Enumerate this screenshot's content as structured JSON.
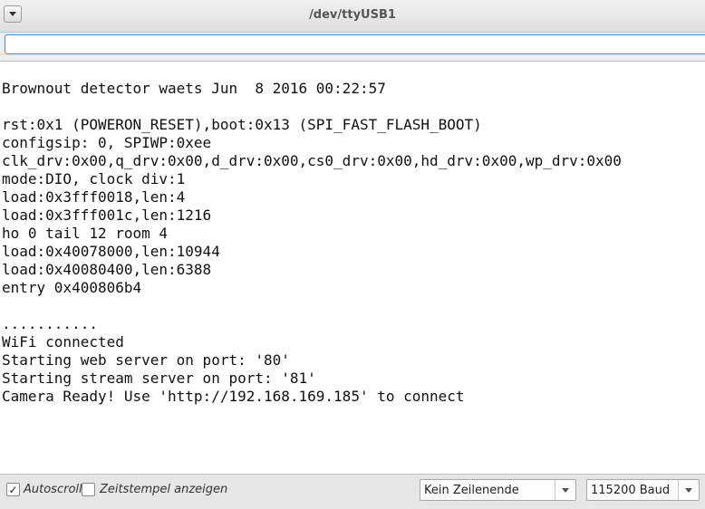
{
  "window": {
    "title": "/dev/ttyUSB1"
  },
  "send": {
    "value": ""
  },
  "console": {
    "lines": [
      "Brownout detector waets Jun  8 2016 00:22:57",
      "",
      "rst:0x1 (POWERON_RESET),boot:0x13 (SPI_FAST_FLASH_BOOT)",
      "configsip: 0, SPIWP:0xee",
      "clk_drv:0x00,q_drv:0x00,d_drv:0x00,cs0_drv:0x00,hd_drv:0x00,wp_drv:0x00",
      "mode:DIO, clock div:1",
      "load:0x3fff0018,len:4",
      "load:0x3fff001c,len:1216",
      "ho 0 tail 12 room 4",
      "load:0x40078000,len:10944",
      "load:0x40080400,len:6388",
      "entry 0x400806b4",
      "",
      "...........",
      "WiFi connected",
      "Starting web server on port: '80'",
      "Starting stream server on port: '81'",
      "Camera Ready! Use 'http://192.168.169.185' to connect"
    ]
  },
  "status": {
    "autoscroll_label": "Autoscroll",
    "autoscroll_checked": true,
    "check_mark": "✓",
    "timestamp_label": "Zeitstempel anzeigen",
    "timestamp_checked": false,
    "line_ending": "Kein Zeilenende",
    "baud": "115200 Baud"
  }
}
